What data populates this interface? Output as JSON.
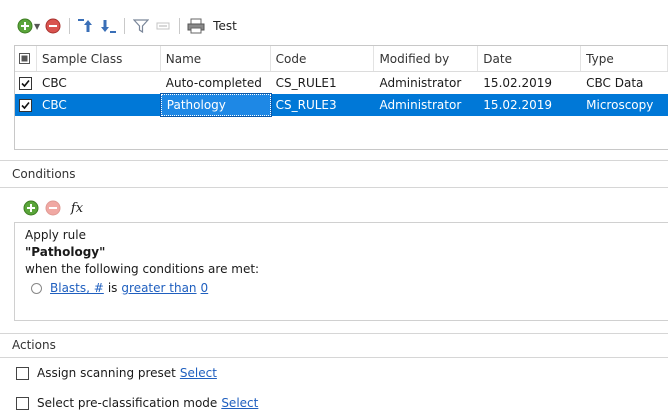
{
  "toolbar": {
    "icons": [
      "add-icon",
      "dropdown-arrow-icon",
      "remove-icon",
      "move-up-icon",
      "move-down-icon",
      "filter-icon",
      "filter-clear-icon",
      "print-icon"
    ],
    "test_label": "Test",
    "colors": {
      "add": "#5aa53a",
      "remove": "#d9534f"
    }
  },
  "rules_grid": {
    "columns": [
      "Sample Class",
      "Name",
      "Code",
      "Modified by",
      "Date",
      "Type"
    ],
    "rows": [
      {
        "checked": true,
        "sample_class": "CBC",
        "name": "Auto-completed",
        "code": "CS_RULE1",
        "modified_by": "Administrator",
        "date": "15.02.2019",
        "type": "CBC Data",
        "selected": false
      },
      {
        "checked": true,
        "sample_class": "CBC",
        "name": "Pathology",
        "code": "CS_RULE3",
        "modified_by": "Administrator",
        "date": "15.02.2019",
        "type": "Microscopy",
        "selected": true
      }
    ],
    "selection_color": "#0078d7"
  },
  "conditions": {
    "title": "Conditions",
    "fx_label": "fx",
    "apply_rule_text": "Apply rule",
    "rule_name": "\"Pathology\"",
    "when_text": "when the following conditions are met:",
    "condition": {
      "field": "Blasts, #",
      "is_text": "is",
      "operator": "greater than",
      "value": "0"
    }
  },
  "actions": {
    "title": "Actions",
    "items": [
      {
        "label": "Assign scanning preset",
        "link": "Select"
      },
      {
        "label": "Select pre-classification mode",
        "link": "Select"
      }
    ]
  }
}
